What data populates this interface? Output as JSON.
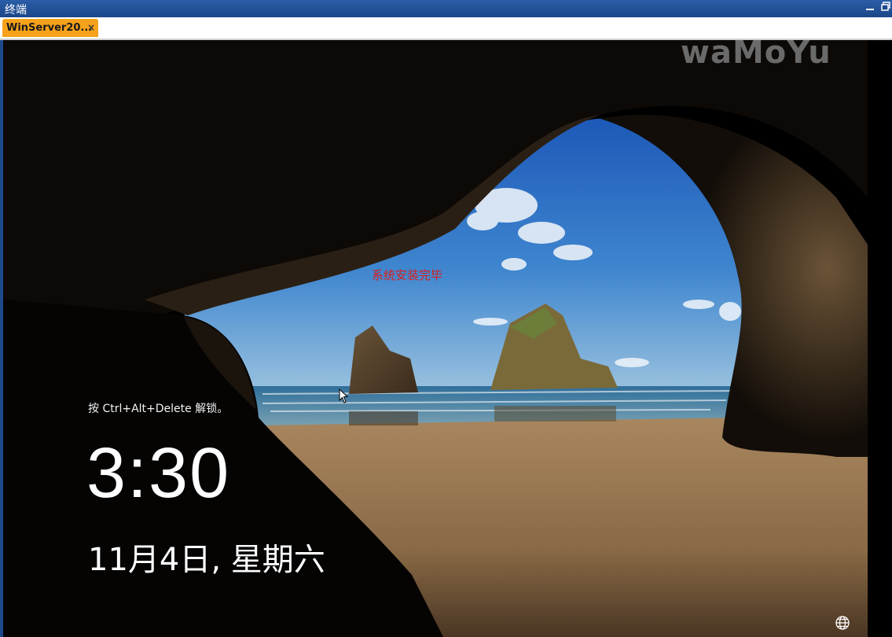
{
  "window": {
    "title": "终端",
    "minimize_icon": "minimize-icon",
    "restore_icon": "restore-icon"
  },
  "tabs": [
    {
      "label": "WinServer20...",
      "close": "×"
    }
  ],
  "lockscreen": {
    "watermark": "waMoYu",
    "install_message": "系统安装完毕",
    "unlock_hint": "按 Ctrl+Alt+Delete 解锁。",
    "time": "3:30",
    "date": "11月4日, 星期六",
    "network_icon": "network-globe-icon",
    "cursor_icon": "mouse-pointer-icon"
  },
  "colors": {
    "title_bar": "#1d4a8c",
    "tab_active": "#f6a21a",
    "install_message": "#d81e1e"
  }
}
